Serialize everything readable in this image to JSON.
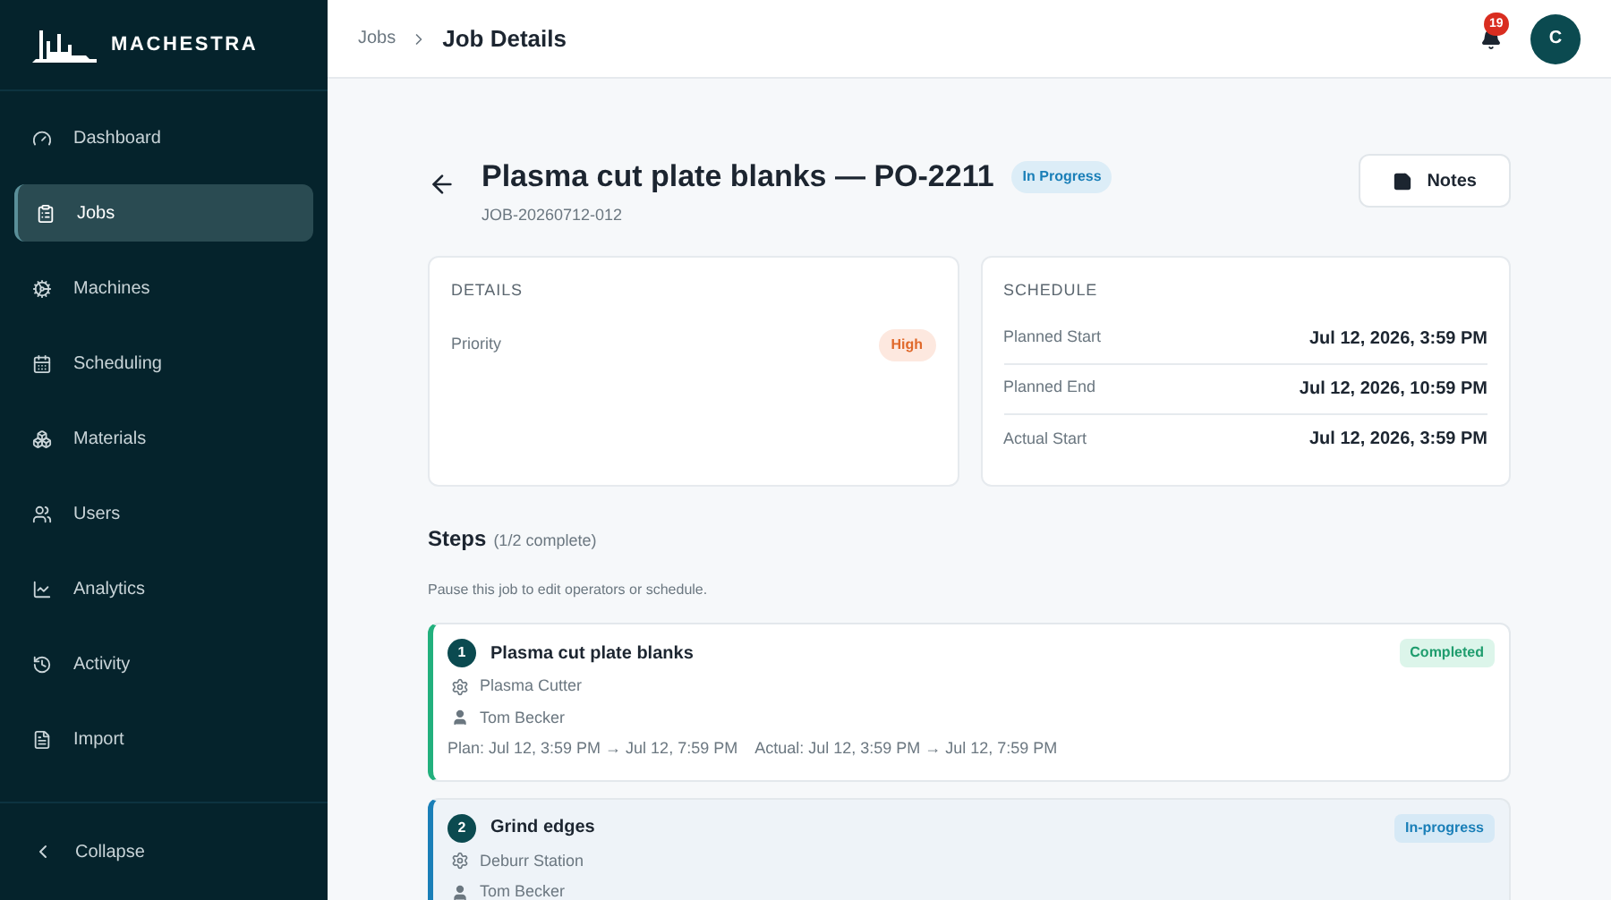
{
  "brand": "MACHESTRA",
  "nav": [
    {
      "label": "Dashboard",
      "selected": false
    },
    {
      "label": "Jobs",
      "selected": true
    },
    {
      "label": "Machines",
      "selected": false
    },
    {
      "label": "Scheduling",
      "selected": false
    },
    {
      "label": "Materials",
      "selected": false
    },
    {
      "label": "Users",
      "selected": false
    },
    {
      "label": "Analytics",
      "selected": false
    },
    {
      "label": "Activity",
      "selected": false
    },
    {
      "label": "Import",
      "selected": false
    }
  ],
  "collapse": "Collapse",
  "breadcrumb": {
    "parent": "Jobs",
    "current": "Job Details"
  },
  "notifications": "19",
  "avatar": "C",
  "job": {
    "title": "Plasma cut plate blanks — PO-2211",
    "status": "In Progress",
    "code": "JOB-20260712-012",
    "notes_button": "Notes"
  },
  "details": {
    "title": "DETAILS",
    "priority_label": "Priority",
    "priority": "High"
  },
  "schedule": {
    "title": "SCHEDULE",
    "rows": [
      {
        "label": "Planned Start",
        "value": "Jul 12, 2026, 3:59 PM"
      },
      {
        "label": "Planned End",
        "value": "Jul 12, 2026, 10:59 PM"
      },
      {
        "label": "Actual Start",
        "value": "Jul 12, 2026, 3:59 PM"
      }
    ]
  },
  "steps": {
    "title": "Steps",
    "progress": "(1/2 complete)",
    "hint": "Pause this job to edit operators or schedule.",
    "items": [
      {
        "number": "1",
        "name": "Plasma cut plate blanks",
        "status": "Completed",
        "kind": "completed",
        "machine": "Plasma Cutter",
        "operator": "Tom Becker",
        "times": "Plan: Jul 12, 3:59 PM → Jul 12, 7:59 PM    Actual: Jul 12, 3:59 PM → Jul 12, 7:59 PM"
      },
      {
        "number": "2",
        "name": "Grind edges",
        "status": "In-progress",
        "kind": "in_progress",
        "machine": "Deburr Station",
        "operator": "Tom Becker"
      }
    ]
  }
}
